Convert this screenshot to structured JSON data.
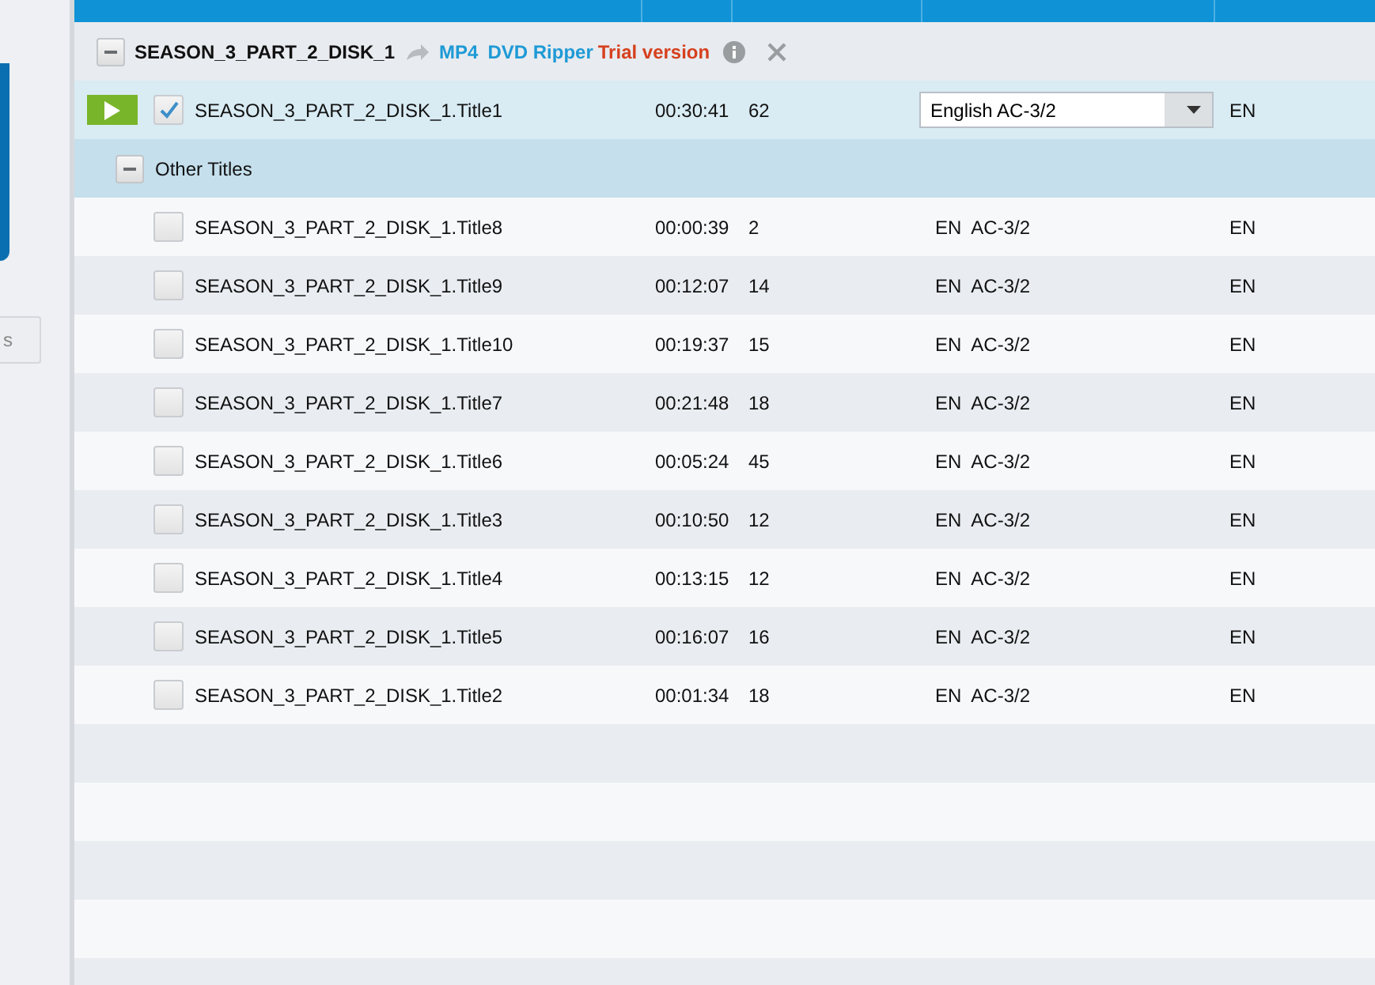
{
  "sidebar": {
    "button": {
      "label": "s"
    }
  },
  "disc": {
    "name": "SEASON_3_PART_2_DISK_1",
    "expanded": true,
    "format": "MP4",
    "product": "DVD Ripper",
    "edition": "Trial version"
  },
  "main_title": {
    "name": "SEASON_3_PART_2_DISK_1.Title1",
    "checked": true,
    "runtime": "00:30:41",
    "chapters": "62",
    "audio": "English AC-3/2",
    "subtitle": "EN"
  },
  "other_titles": {
    "label": "Other Titles",
    "expanded": true,
    "titles": [
      {
        "name": "SEASON_3_PART_2_DISK_1.Title8",
        "checked": false,
        "runtime": "00:00:39",
        "chapters": "2",
        "audio": "EN  AC-3/2",
        "subtitle": "EN"
      },
      {
        "name": "SEASON_3_PART_2_DISK_1.Title9",
        "checked": false,
        "runtime": "00:12:07",
        "chapters": "14",
        "audio": "EN  AC-3/2",
        "subtitle": "EN"
      },
      {
        "name": "SEASON_3_PART_2_DISK_1.Title10",
        "checked": false,
        "runtime": "00:19:37",
        "chapters": "15",
        "audio": "EN  AC-3/2",
        "subtitle": "EN"
      },
      {
        "name": "SEASON_3_PART_2_DISK_1.Title7",
        "checked": false,
        "runtime": "00:21:48",
        "chapters": "18",
        "audio": "EN  AC-3/2",
        "subtitle": "EN"
      },
      {
        "name": "SEASON_3_PART_2_DISK_1.Title6",
        "checked": false,
        "runtime": "00:05:24",
        "chapters": "45",
        "audio": "EN  AC-3/2",
        "subtitle": "EN"
      },
      {
        "name": "SEASON_3_PART_2_DISK_1.Title3",
        "checked": false,
        "runtime": "00:10:50",
        "chapters": "12",
        "audio": "EN  AC-3/2",
        "subtitle": "EN"
      },
      {
        "name": "SEASON_3_PART_2_DISK_1.Title4",
        "checked": false,
        "runtime": "00:13:15",
        "chapters": "12",
        "audio": "EN  AC-3/2",
        "subtitle": "EN"
      },
      {
        "name": "SEASON_3_PART_2_DISK_1.Title5",
        "checked": false,
        "runtime": "00:16:07",
        "chapters": "16",
        "audio": "EN  AC-3/2",
        "subtitle": "EN"
      },
      {
        "name": "SEASON_3_PART_2_DISK_1.Title2",
        "checked": false,
        "runtime": "00:01:34",
        "chapters": "18",
        "audio": "EN  AC-3/2",
        "subtitle": "EN"
      }
    ]
  }
}
